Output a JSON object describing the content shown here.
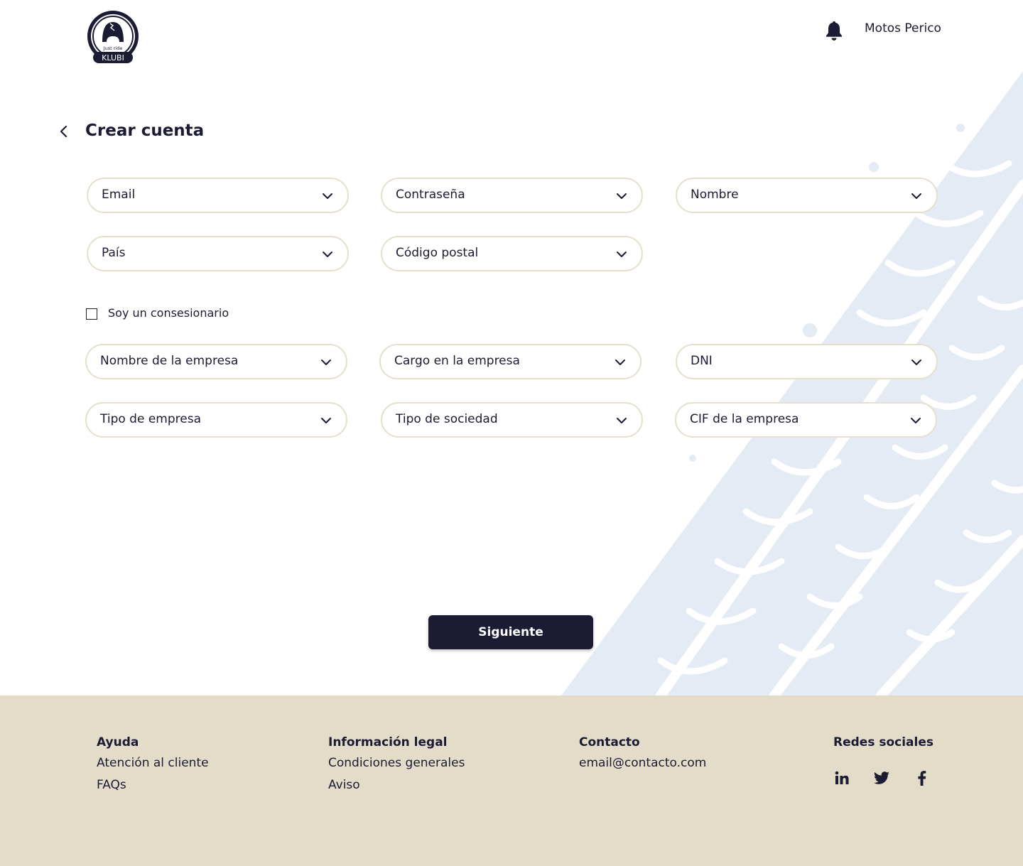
{
  "header": {
    "logo": {
      "tagline": "Just ride",
      "brand": "KLUBI"
    },
    "user_name": "Motos Perico"
  },
  "page": {
    "title": "Crear cuenta"
  },
  "form": {
    "fields": [
      {
        "label": "Email"
      },
      {
        "label": "Contraseña"
      },
      {
        "label": "Nombre"
      },
      {
        "label": "País"
      },
      {
        "label": "Código postal"
      }
    ],
    "dealer_checkbox": {
      "label": "Soy un consesionario",
      "checked": false
    },
    "company_fields": [
      {
        "label": "Nombre de la empresa"
      },
      {
        "label": "Cargo en la empresa"
      },
      {
        "label": "DNI"
      },
      {
        "label": "Tipo de empresa"
      },
      {
        "label": "Tipo de sociedad"
      },
      {
        "label": "CIF de la empresa"
      }
    ],
    "next_button": "Siguiente"
  },
  "footer": {
    "help": {
      "title": "Ayuda",
      "links": [
        "Atención al cliente",
        "FAQs"
      ]
    },
    "legal": {
      "title": "Información legal",
      "links": [
        "Condiciones generales",
        "Aviso"
      ]
    },
    "contact": {
      "title": "Contacto",
      "email": "email@contacto.com"
    },
    "social": {
      "title": "Redes sociales",
      "icons": [
        "linkedin-icon",
        "twitter-icon",
        "facebook-icon"
      ]
    }
  },
  "colors": {
    "primary": "#1b1b33",
    "field_border": "#e6dfcc",
    "footer_bg": "#e3dcc9",
    "track_pattern": "#e4ebf4"
  }
}
